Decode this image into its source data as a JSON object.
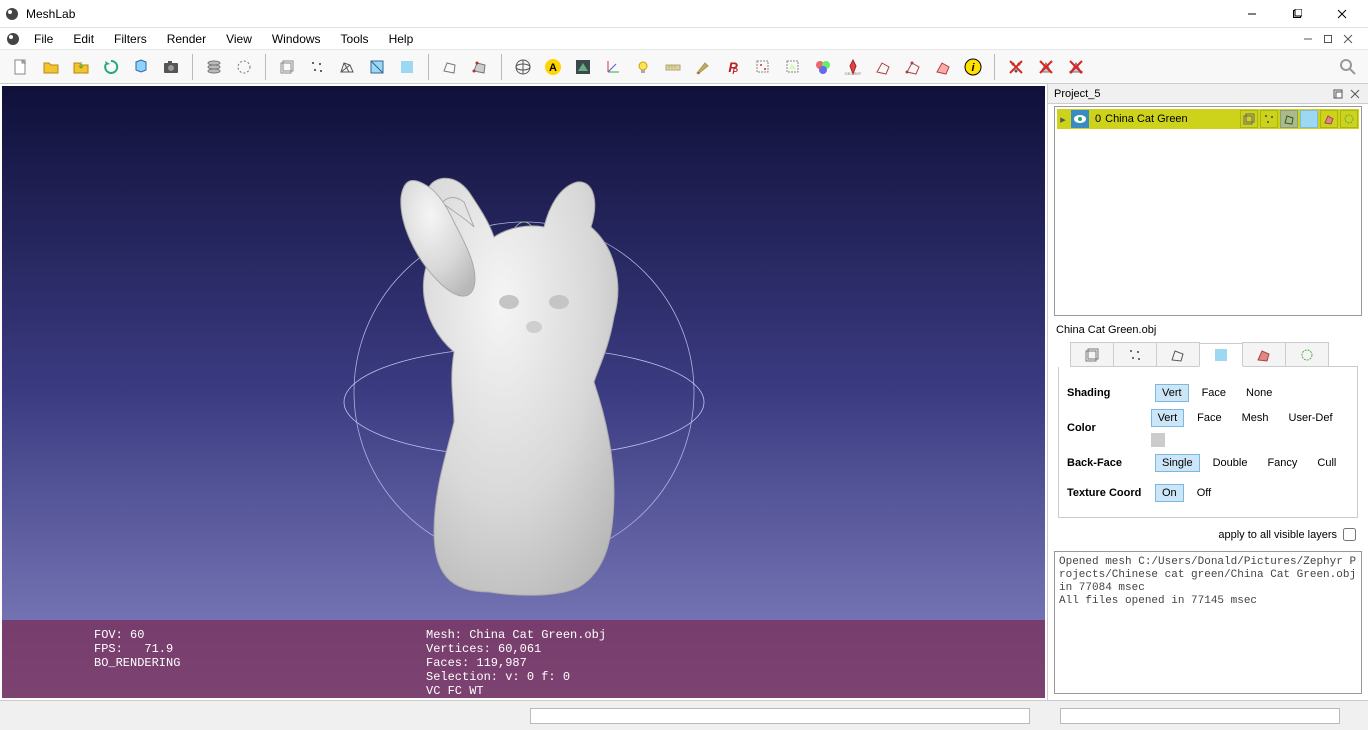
{
  "app": {
    "title": "MeshLab"
  },
  "menu": {
    "items": [
      "File",
      "Edit",
      "Filters",
      "Render",
      "View",
      "Windows",
      "Tools",
      "Help"
    ]
  },
  "dock": {
    "title": "Project_5"
  },
  "layer": {
    "index": "0",
    "name": "China Cat Green"
  },
  "layer_label": "China Cat Green.obj",
  "params": {
    "shading": {
      "label": "Shading",
      "opts": [
        "Vert",
        "Face",
        "None"
      ],
      "active": 0
    },
    "color": {
      "label": "Color",
      "opts": [
        "Vert",
        "Face",
        "Mesh",
        "User-Def"
      ],
      "active": 0
    },
    "backface": {
      "label": "Back-Face",
      "opts": [
        "Single",
        "Double",
        "Fancy",
        "Cull"
      ],
      "active": 0
    },
    "texcoord": {
      "label": "Texture Coord",
      "opts": [
        "On",
        "Off"
      ],
      "active": 0
    }
  },
  "apply": "apply to all visible layers",
  "info_left": {
    "l0": "FOV: 60",
    "l1": "FPS:   71.9",
    "l2": "BO_RENDERING"
  },
  "info_right": {
    "l0": "Mesh: China Cat Green.obj",
    "l1": "Vertices: 60,061",
    "l2": "Faces: 119,987",
    "l3": "Selection: v: 0 f: 0",
    "l4": "VC FC WT"
  },
  "log": "Opened mesh C:/Users/Donald/Pictures/Zephyr Projects/Chinese cat green/China Cat Green.obj in 77084 msec\nAll files opened in 77145 msec"
}
